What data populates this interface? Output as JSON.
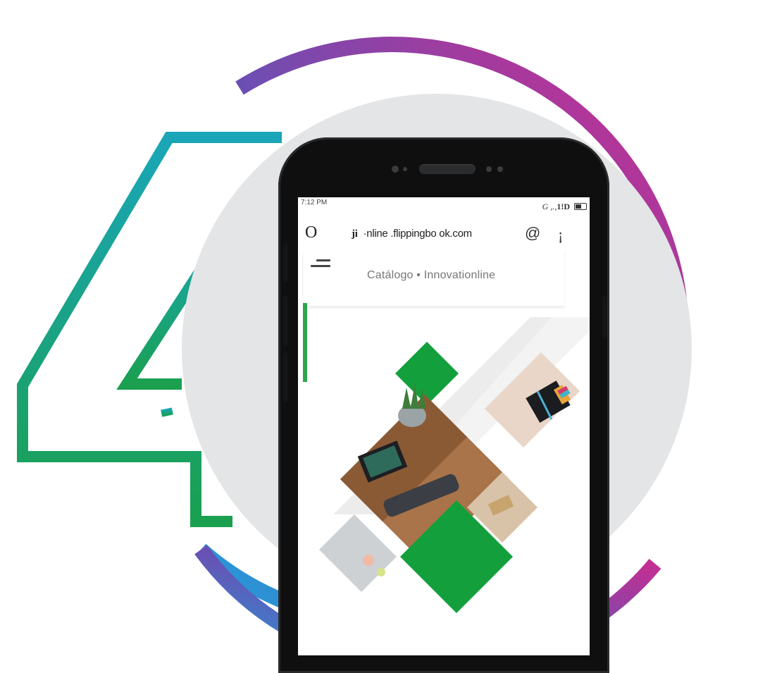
{
  "colors": {
    "ring_gradient": [
      "#1fa0dc",
      "#6a4fb3",
      "#d12a8e"
    ],
    "four_gradient": [
      "#1aa6b8",
      "#1aa04f"
    ],
    "backdrop_disc": "#e3e5e6",
    "accent_green": "#13a03c",
    "phone_body": "#0f0f10"
  },
  "status_bar": {
    "time": "7:12 PM",
    "right_text": "G ,.,",
    "right_bold": "1!D"
  },
  "browser": {
    "leading_glyph": "O",
    "url_prefix": "ji",
    "url": "·nline .flippingbo ok.com",
    "at_icon": "@",
    "info_icon": "¡"
  },
  "page": {
    "title": "Catálogo • Innovationline",
    "menu_icon": "hamburger-menu-icon"
  }
}
